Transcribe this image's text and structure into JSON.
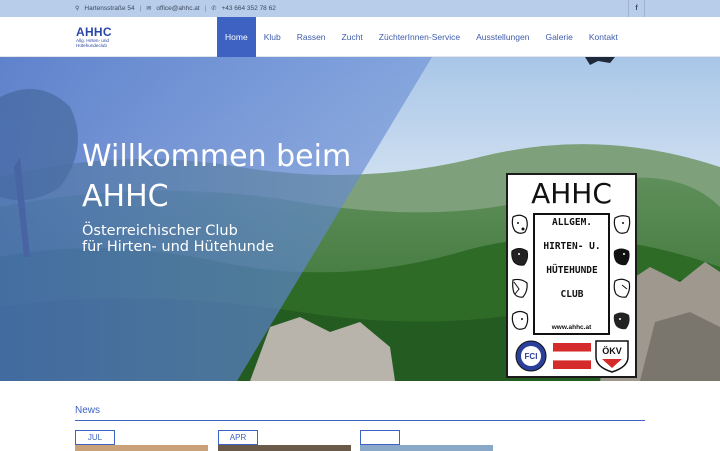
{
  "topbar": {
    "address": "Hartensstraße 54",
    "email": "office@ahhc.at",
    "phone": "+43 664 352 78 62",
    "facebook_label": "f"
  },
  "logo": {
    "title": "AHHC",
    "line1": "Allg. Hirten- und",
    "line2": "Hütehundeclub"
  },
  "nav": {
    "items": [
      {
        "label": "Home",
        "active": true
      },
      {
        "label": "Klub"
      },
      {
        "label": "Rassen"
      },
      {
        "label": "Zucht"
      },
      {
        "label": "ZüchterInnen-Service"
      },
      {
        "label": "Ausstellungen"
      },
      {
        "label": "Galerie"
      },
      {
        "label": "Kontakt"
      }
    ]
  },
  "hero": {
    "title": "Willkommen beim AHHC",
    "subtitle_line1": "Österreichischer Club",
    "subtitle_line2": "für Hirten- und Hütehunde"
  },
  "badge": {
    "ahhc": "AHHC",
    "line1": "ALLGEM.",
    "line2": "HIRTEN- U.",
    "line3": "HÜTEHUNDE",
    "line4": "CLUB",
    "www": "www.ahhc.at",
    "fci": "FCI",
    "okv": "ÖKV"
  },
  "news": {
    "title": "News",
    "cards": [
      {
        "month": "JUL"
      },
      {
        "month": "APR"
      },
      {
        "month": ""
      }
    ]
  },
  "colors": {
    "accent": "#3d62c2",
    "topbar": "#b7cdea"
  }
}
